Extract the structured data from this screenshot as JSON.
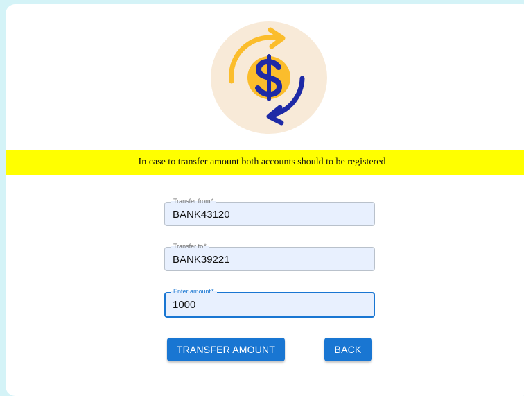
{
  "logo": {
    "icon": "dollar-transfer-icon",
    "colors": {
      "background": "#f8ead8",
      "coin": "#fbbd2c",
      "dollar": "#1e2aa6",
      "arrow_top": "#fbbd2c",
      "arrow_bottom": "#1e2aa6"
    }
  },
  "notice": {
    "text": "In case to transfer amount both accounts should to be registered",
    "background": "#ffff00"
  },
  "form": {
    "transfer_from": {
      "label": "Transfer from",
      "required_mark": "*",
      "value": "BANK43120"
    },
    "transfer_to": {
      "label": "Transfer to",
      "required_mark": "*",
      "value": "BANK39221"
    },
    "amount": {
      "label": "Enter amount",
      "required_mark": "*",
      "value": "1000"
    }
  },
  "actions": {
    "transfer_label": "TRANSFER AMOUNT",
    "back_label": "BACK"
  },
  "theme": {
    "page_background": "#d4f3f7",
    "primary": "#1976d2",
    "field_background": "#e8f0fe"
  }
}
